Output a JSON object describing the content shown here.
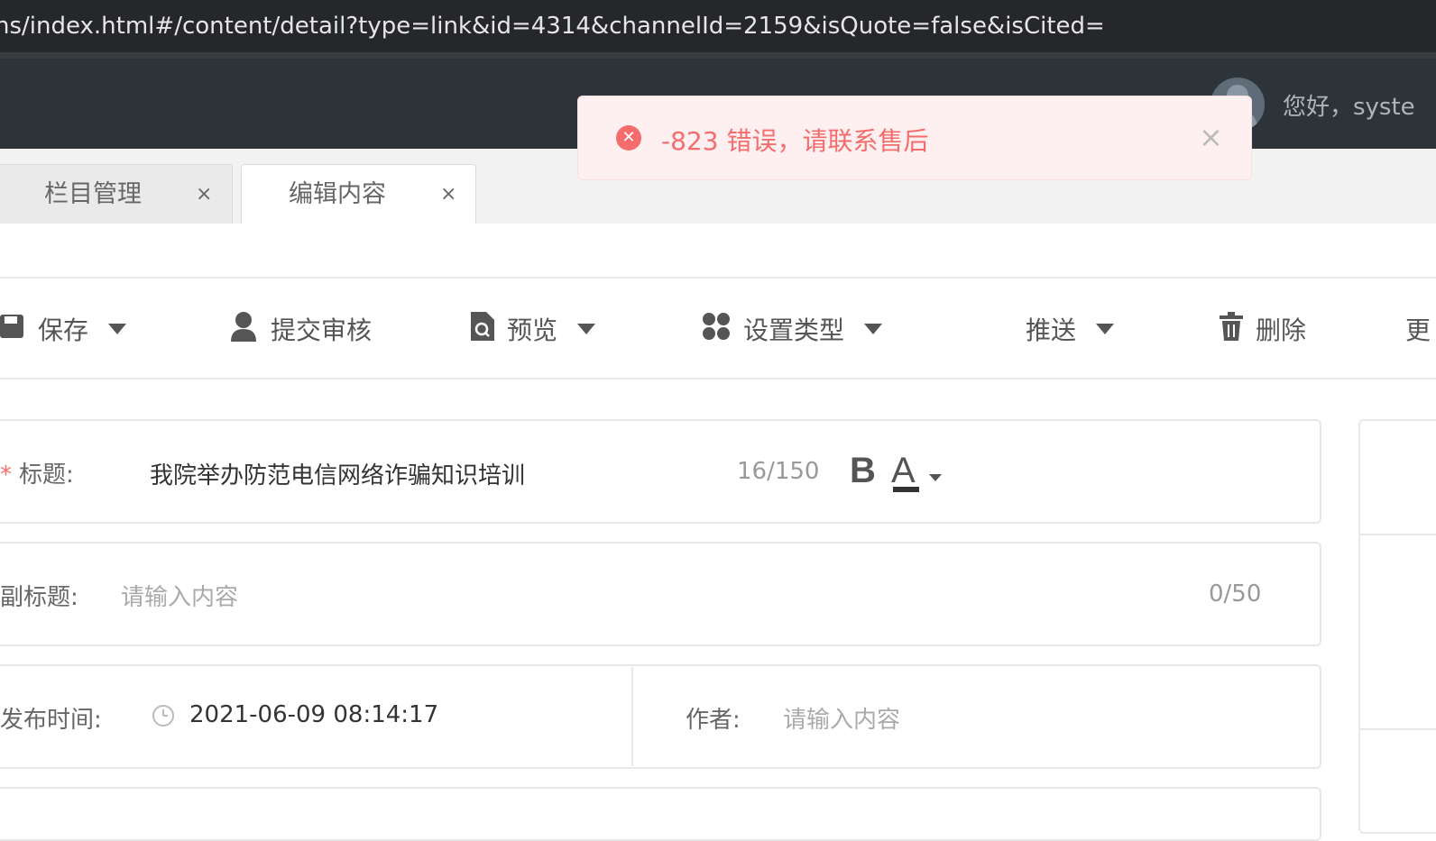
{
  "browser": {
    "url": "ns/index.html#/content/detail?type=link&id=4314&channelId=2159&isQuote=false&isCited="
  },
  "header": {
    "greeting": "您好，syste"
  },
  "tabs": [
    {
      "label": "栏目管理",
      "close": "×"
    },
    {
      "label": "编辑内容",
      "close": "×"
    }
  ],
  "toolbar": {
    "save": "保存",
    "submit_review": "提交审核",
    "preview": "预览",
    "set_type": "设置类型",
    "push": "推送",
    "delete": "删除",
    "more": "更"
  },
  "form": {
    "title": {
      "required_mark": "*",
      "label": "标题:",
      "value": "我院举办防范电信网络诈骗知识培训",
      "counter": "16/150",
      "bold_label": "B",
      "color_label": "A"
    },
    "subtitle": {
      "label": "副标题:",
      "placeholder": "请输入内容",
      "counter": "0/50"
    },
    "publish_time": {
      "label": "发布时间:",
      "value": "2021-06-09 08:14:17"
    },
    "author": {
      "label": "作者:",
      "placeholder": "请输入内容"
    }
  },
  "toast": {
    "type": "error",
    "message": "-823 错误，请联系售后",
    "close": "×"
  },
  "colors": {
    "error": "#f56c6c",
    "header_bg": "#2d3439",
    "url_bar_bg": "#25272a"
  }
}
